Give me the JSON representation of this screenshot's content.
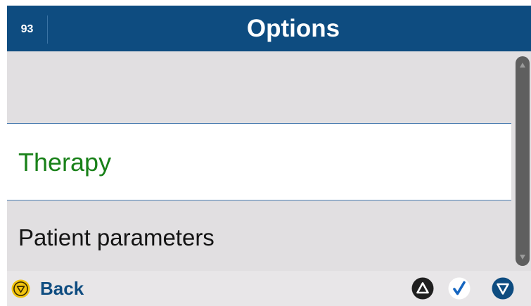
{
  "header": {
    "screen_number": "93",
    "title": "Options"
  },
  "menu": {
    "items": [
      {
        "label": ""
      },
      {
        "label": "Therapy",
        "selected": true
      },
      {
        "label": "Patient parameters"
      }
    ]
  },
  "footer": {
    "back_label": "Back",
    "up_icon": "triangle-up-icon",
    "confirm_icon": "checkmark-icon",
    "down_icon": "triangle-down-icon"
  },
  "colors": {
    "header_bg": "#0e4c80",
    "selected_text": "#198119",
    "back_icon": "#f2c40e",
    "nav_up": "#1f1f1f",
    "nav_confirm": "#1565c0",
    "nav_down": "#0e4c80"
  }
}
